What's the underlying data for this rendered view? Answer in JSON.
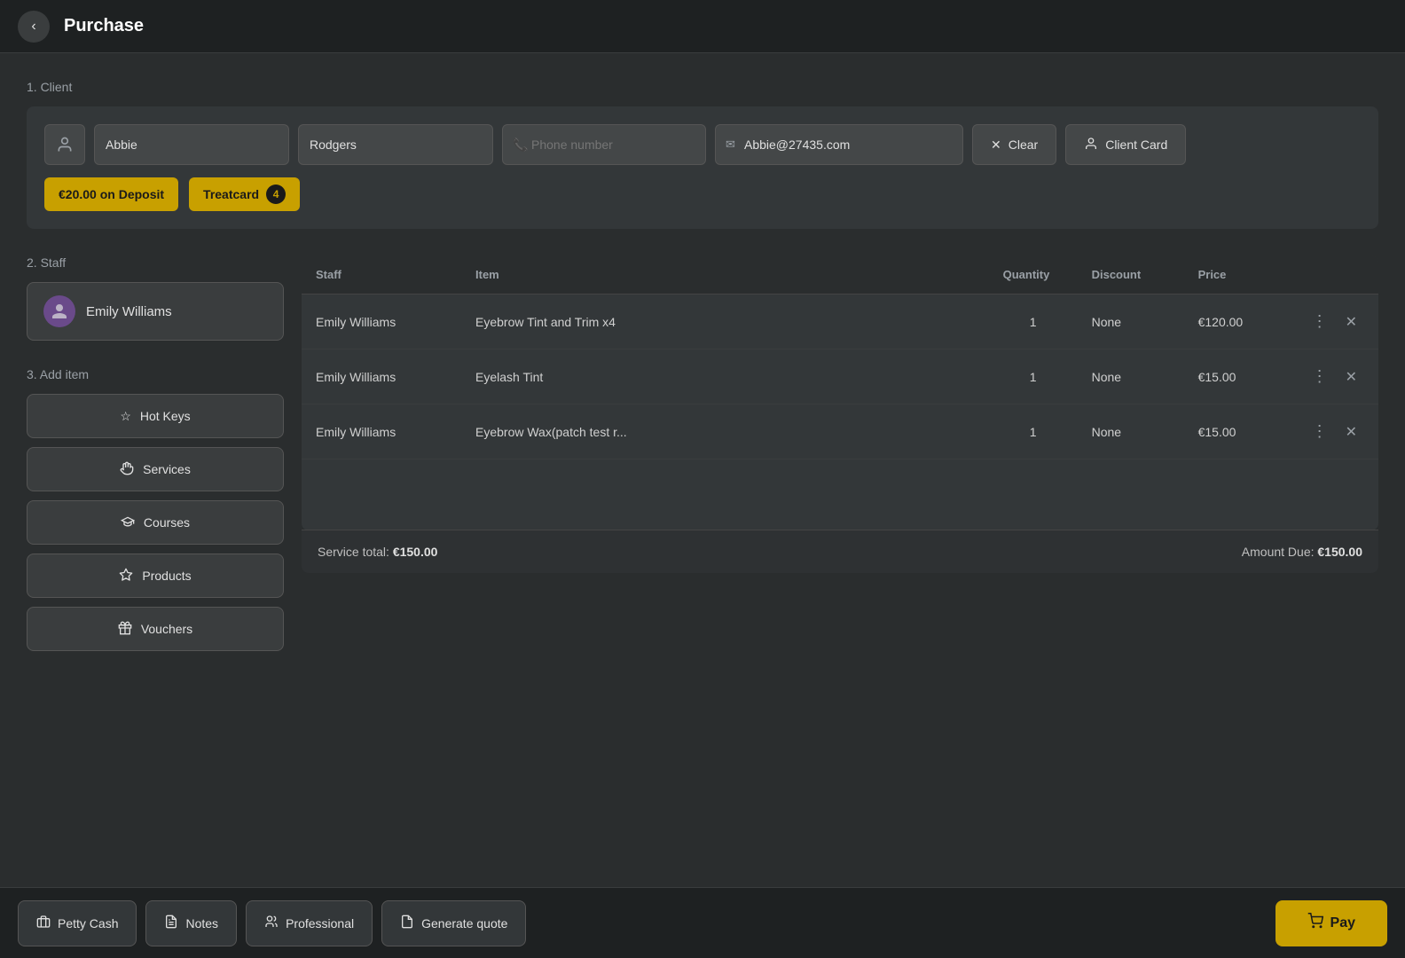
{
  "header": {
    "back_label": "‹",
    "title": "Purchase"
  },
  "client_section": {
    "label": "1. Client",
    "first_name": "Abbie",
    "last_name": "Rodgers",
    "phone_placeholder": "Phone number",
    "email": "Abbie@27435.com",
    "clear_label": "Clear",
    "client_card_label": "Client Card",
    "deposit_label": "€20.00 on Deposit",
    "treatcard_label": "Treatcard",
    "treatcard_count": "4"
  },
  "staff_section": {
    "label": "2. Staff",
    "staff_name": "Emily Williams",
    "avatar_icon": "👤"
  },
  "add_item_section": {
    "label": "3. Add item",
    "buttons": [
      {
        "id": "hot-keys",
        "icon": "☆",
        "label": "Hot Keys"
      },
      {
        "id": "services",
        "icon": "✋",
        "label": "Services"
      },
      {
        "id": "courses",
        "icon": "🎓",
        "label": "Courses"
      },
      {
        "id": "products",
        "icon": "◇",
        "label": "Products"
      },
      {
        "id": "vouchers",
        "icon": "🎁",
        "label": "Vouchers"
      }
    ]
  },
  "table": {
    "columns": [
      "Staff",
      "Item",
      "Quantity",
      "Discount",
      "Price",
      ""
    ],
    "rows": [
      {
        "staff": "Emily Williams",
        "item": "Eyebrow Tint and Trim x4",
        "quantity": "1",
        "discount": "None",
        "price": "€120.00"
      },
      {
        "staff": "Emily Williams",
        "item": "Eyelash Tint",
        "quantity": "1",
        "discount": "None",
        "price": "€15.00"
      },
      {
        "staff": "Emily Williams",
        "item": "Eyebrow Wax(patch test r...",
        "quantity": "1",
        "discount": "None",
        "price": "€15.00"
      }
    ],
    "service_total_label": "Service total:",
    "service_total_value": "€150.00",
    "amount_due_label": "Amount Due:",
    "amount_due_value": "€150.00"
  },
  "footer": {
    "petty_cash_label": "Petty Cash",
    "notes_label": "Notes",
    "professional_label": "Professional",
    "generate_quote_label": "Generate quote",
    "pay_label": "Pay"
  }
}
